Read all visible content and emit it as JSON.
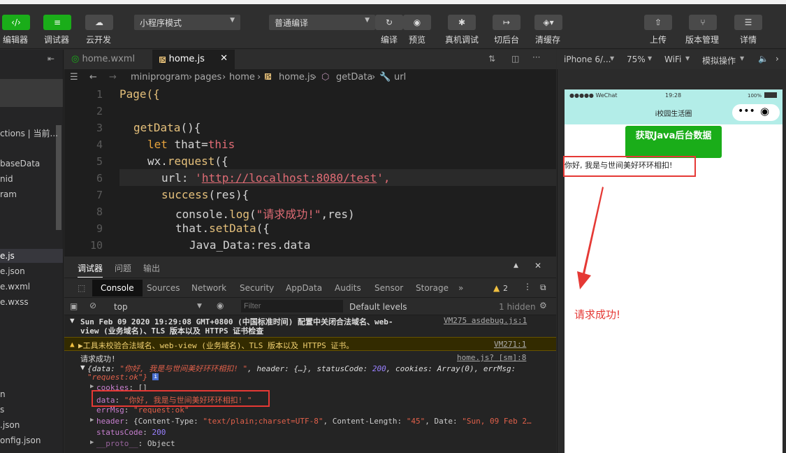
{
  "toolbar": {
    "editor_label": "编辑器",
    "debugger_label": "调试器",
    "cloud_label": "云开发",
    "mode_select": "小程序模式",
    "compile_select": "普通编译",
    "compile_label": "编译",
    "preview_label": "预览",
    "remote_debug_label": "真机调试",
    "background_label": "切后台",
    "clear_cache_label": "清缓存",
    "upload_label": "上传",
    "version_label": "版本管理",
    "details_label": "详情"
  },
  "explorer": {
    "items": [
      "ctions | 当前...",
      "baseData",
      "nid",
      "ram",
      "e.js",
      "e.json",
      "e.wxml",
      "e.wxss",
      "n",
      "s",
      ".json",
      "onfig.json"
    ]
  },
  "editor": {
    "tabs": [
      "home.wxml",
      "home.js"
    ],
    "breadcrumb": [
      "miniprogram",
      "pages",
      "home",
      "home.js",
      "getData",
      "url"
    ],
    "line_numbers": [
      "1",
      "2",
      "3",
      "4",
      "5",
      "6",
      "7",
      "8",
      "9",
      "10"
    ],
    "code": {
      "l1": "Page({",
      "l3a": "getData",
      "l3b": "(){",
      "l4a": "let",
      "l4b": " that=",
      "l4c": "this",
      "l5a": "wx.",
      "l5b": "request",
      "l5c": "({",
      "l6a": "url: ",
      "l6b": "'",
      "l6c": "http://localhost:8080/test",
      "l6d": "',",
      "l7a": "success",
      "l7b": "(res){",
      "l8a": "console.",
      "l8b": "log",
      "l8c": "(",
      "l8d": "\"请求成功!\"",
      "l8e": ",res)",
      "l9a": "that.",
      "l9b": "setData",
      "l9c": "({",
      "l10": "Java_Data:res.data"
    }
  },
  "console": {
    "top_tabs": [
      "调试器",
      "问题",
      "输出"
    ],
    "tabs": [
      "Console",
      "Sources",
      "Network",
      "Security",
      "AppData",
      "Audits",
      "Sensor",
      "Storage"
    ],
    "more": "»",
    "warn_count": "2",
    "context": "top",
    "filter_placeholder": "Filter",
    "levels": "Default levels",
    "hidden": "1 hidden",
    "row1_text": "Sun Feb 09 2020 19:29:08 GMT+0800 (中国标准时间) 配置中关闭合法域名、web-",
    "row1_text2": "view (业务域名)、TLS 版本以及 HTTPS 证书检查",
    "row1_src": "VM275 asdebug.js:1",
    "row2_text": "▶工具未校验合法域名、web-view (业务域名)、TLS 版本以及 HTTPS 证书。",
    "row2_src": "VM271:1",
    "log_title": "请求成功!",
    "log_src": "home.js? [sm]:8",
    "obj_line1a": "{data: ",
    "obj_line1b": "\"你好, 我是与世间美好环环相扣! \"",
    "obj_line1c": ", header: {…}, statusCode: ",
    "obj_line1d": "200",
    "obj_line1e": ", cookies: ",
    "obj_line1f": "Array(0)",
    "obj_line1g": ", errMsg:",
    "obj_line2": "\"request:ok\"}",
    "cookies_key": "cookies",
    "cookies_val": ": []",
    "data_key": "data",
    "data_val": "\"你好, 我是与世间美好环环相扣! \"",
    "errmsg_key": "errMsg",
    "errmsg_val": "\"request:ok\"",
    "header_key": "header",
    "header_val1": ": {Content-Type: ",
    "header_val2": "\"text/plain;charset=UTF-8\"",
    "header_val3": ", Content-Length: ",
    "header_val4": "\"45\"",
    "header_val5": ", Date: ",
    "header_val6": "\"Sun, 09 Feb 2…",
    "status_key": "statusCode",
    "status_val": "200",
    "proto_key": "__proto__",
    "proto_val": ": Object"
  },
  "simulator": {
    "device": "iPhone 6/...",
    "zoom": "75%",
    "network": "WiFi",
    "simulate": "模拟操作",
    "carrier": "●●●●● WeChat",
    "time": "19:28",
    "battery": "100%",
    "page_title": "i校园生活圈",
    "button_label": "获取Java后台数据",
    "greeting": "你好, 我是与世间美好环环相扣!",
    "annotation": "请求成功!"
  },
  "colors": {
    "accent_green": "#1aad19",
    "annotation_red": "#e53935",
    "nav_teal": "#b3ede8"
  }
}
